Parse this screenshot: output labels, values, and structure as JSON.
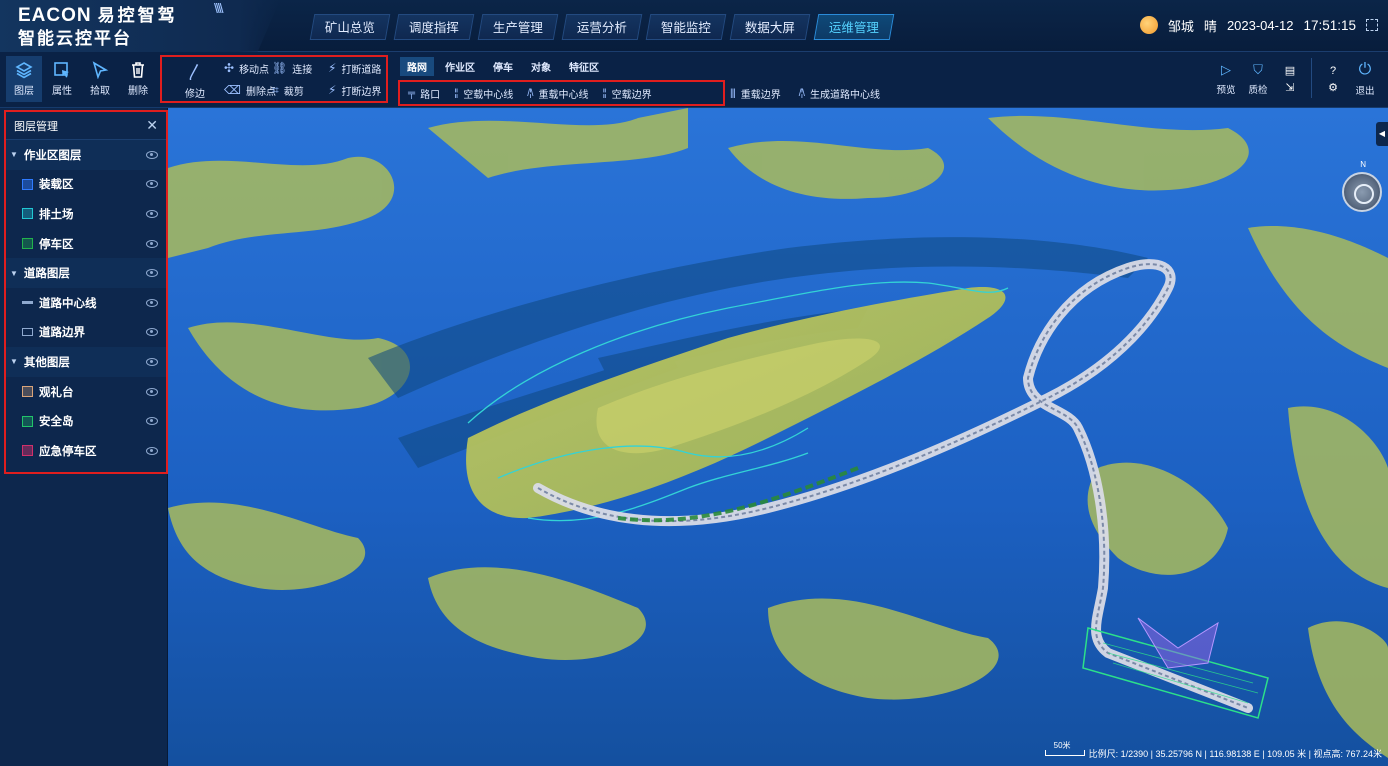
{
  "app": {
    "brand_en": "EACON",
    "brand_cn": "易控智驾",
    "subtitle": "智能云控平台"
  },
  "nav": {
    "tabs": [
      "矿山总览",
      "调度指挥",
      "生产管理",
      "运营分析",
      "智能监控",
      "数据大屏",
      "运维管理"
    ],
    "active": "运维管理"
  },
  "status": {
    "city": "邹城",
    "weather": "晴",
    "date": "2023-04-12",
    "time": "17:51:15"
  },
  "toolbar": {
    "main_tools": [
      "图层",
      "属性",
      "拾取",
      "删除"
    ],
    "edit_tools": {
      "move_point": "移动点",
      "delete_point": "删除点",
      "edit_edge": "修边",
      "connect": "连接",
      "crop": "裁剪",
      "break_road": "打断道路",
      "break_border": "打断边界"
    },
    "road_tabs": [
      "路网",
      "作业区",
      "停车",
      "对象",
      "特征区"
    ],
    "road_tools": [
      "路口",
      "空载中心线",
      "重载中心线",
      "空载边界"
    ],
    "road_tools_ext": [
      "重载边界",
      "生成道路中心线"
    ],
    "right_tools": [
      "预览",
      "质检",
      "退出"
    ]
  },
  "layers": {
    "title": "图层管理",
    "groups": [
      {
        "name": "作业区图层",
        "items": [
          {
            "name": "装载区",
            "color": "#2f7bff"
          },
          {
            "name": "排土场",
            "color": "#21c7d3"
          },
          {
            "name": "停车区",
            "color": "#22b24c"
          }
        ]
      },
      {
        "name": "道路图层",
        "items": [
          {
            "name": "道路中心线",
            "color": "#8fa9cf"
          },
          {
            "name": "道路边界",
            "color": "#8fa9cf"
          }
        ]
      },
      {
        "name": "其他图层",
        "items": [
          {
            "name": "观礼台",
            "color": "#d9a47a"
          },
          {
            "name": "安全岛",
            "color": "#22c46a"
          },
          {
            "name": "应急停车区",
            "color": "#d0306b"
          }
        ]
      }
    ]
  },
  "map": {
    "compass_label": "N",
    "scale_label": "50米",
    "info": "比例尺: 1/2390 | 35.25796 N | 116.98138 E | 109.05 米 | 视点高: 767.24米"
  },
  "colors": {
    "accent": "#55d2ff",
    "highlight_box": "#e01e1e",
    "terrain_high": "#b7c25a",
    "terrain_low": "#1b63c4"
  }
}
